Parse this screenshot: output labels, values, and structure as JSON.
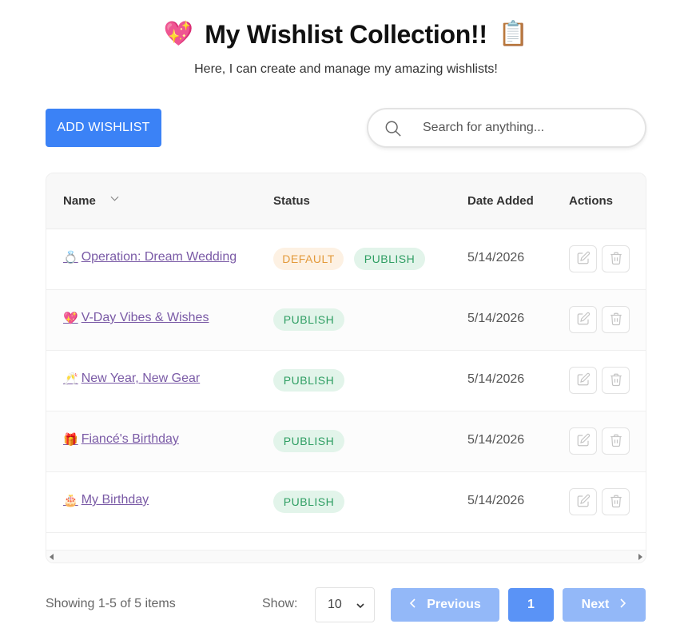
{
  "header": {
    "title": "My Wishlist Collection!!",
    "title_emoji_left": "💖",
    "title_emoji_right": "📋",
    "subtitle": "Here, I can create and manage my amazing wishlists!"
  },
  "toolbar": {
    "add_label": "ADD WISHLIST",
    "search_placeholder": "Search for anything..."
  },
  "table": {
    "columns": {
      "name": "Name",
      "status": "Status",
      "date": "Date Added",
      "actions": "Actions"
    },
    "rows": [
      {
        "emoji": "💍",
        "name": "Operation: Dream Wedding",
        "badges": [
          "DEFAULT",
          "PUBLISH"
        ],
        "date": "5/14/2026"
      },
      {
        "emoji": "💖",
        "name": "V-Day Vibes & Wishes",
        "badges": [
          "PUBLISH"
        ],
        "date": "5/14/2026"
      },
      {
        "emoji": "🥂",
        "name": "New Year, New Gear",
        "badges": [
          "PUBLISH"
        ],
        "date": "5/14/2026"
      },
      {
        "emoji": "🎁",
        "name": "Fiancé's Birthday",
        "badges": [
          "PUBLISH"
        ],
        "date": "5/14/2026"
      },
      {
        "emoji": "🎂",
        "name": "My Birthday",
        "badges": [
          "PUBLISH"
        ],
        "date": "5/14/2026"
      }
    ]
  },
  "footer": {
    "showing": "Showing 1-5 of 5 items",
    "show_label": "Show:",
    "page_size": "10",
    "prev_label": "Previous",
    "current_page": "1",
    "next_label": "Next"
  },
  "colors": {
    "primary": "#3b82f6",
    "link": "#7a5aa6",
    "default_badge_bg": "#fdf1e3",
    "default_badge_text": "#e39a3b",
    "publish_badge_bg": "#e2f4ea",
    "publish_badge_text": "#2f9e63"
  },
  "icons": [
    "search-icon",
    "sort-chevron-icon",
    "edit-icon",
    "trash-icon",
    "chevron-left-icon",
    "chevron-right-icon",
    "chevron-down-icon"
  ]
}
